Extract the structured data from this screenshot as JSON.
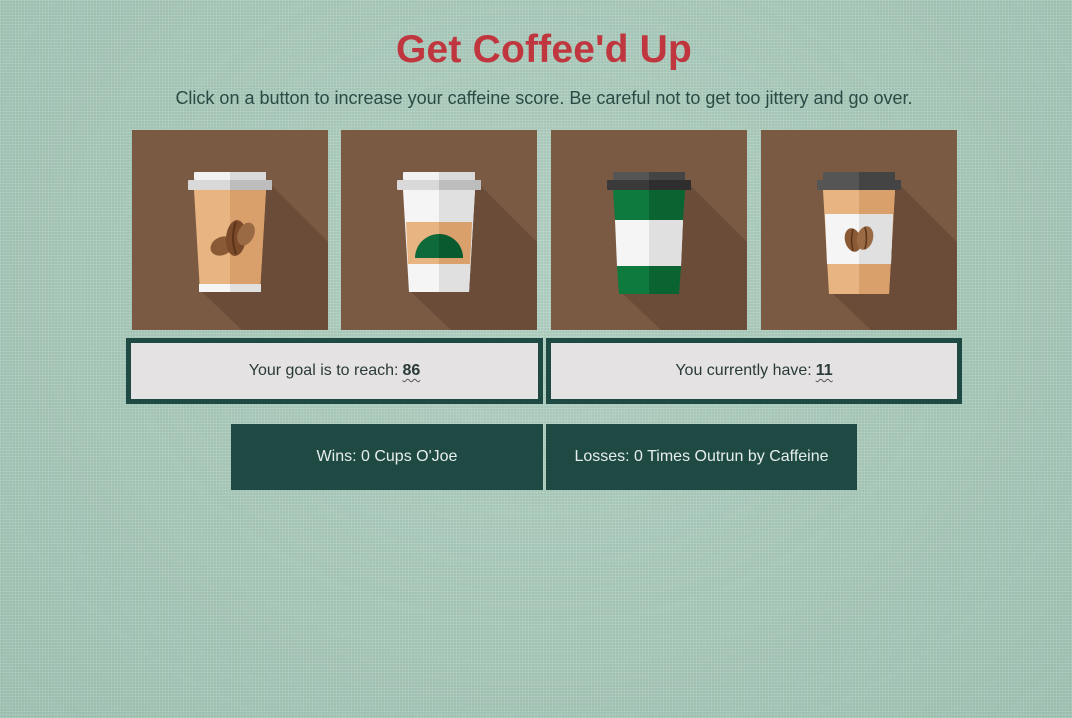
{
  "game": {
    "title": "Get Coffee'd Up",
    "instructions": "Click on a button to increase your caffeine score. Be careful not to get too jittery and go over."
  },
  "cups": [
    {
      "name": "coffee-bean-cup-icon",
      "style": "tan cup with coffee beans"
    },
    {
      "name": "green-logo-cup-icon",
      "style": "white cup with green logo"
    },
    {
      "name": "green-band-cup-icon",
      "style": "green and white cup"
    },
    {
      "name": "dark-lid-bean-cup-icon",
      "style": "tan cup with dark lid and beans"
    }
  ],
  "goal": {
    "label": "Your goal is to reach:",
    "value": "86"
  },
  "current": {
    "label": "You currently have:",
    "value": "11"
  },
  "wins": {
    "text": "Wins: 0 Cups O'Joe"
  },
  "losses": {
    "text": "Losses: 0 Times Outrun by Caffeine"
  },
  "colors": {
    "title": "#c0363e",
    "tile": "#7a5a42",
    "dark_green": "#1f4a43",
    "background": "#a9cdbd"
  }
}
